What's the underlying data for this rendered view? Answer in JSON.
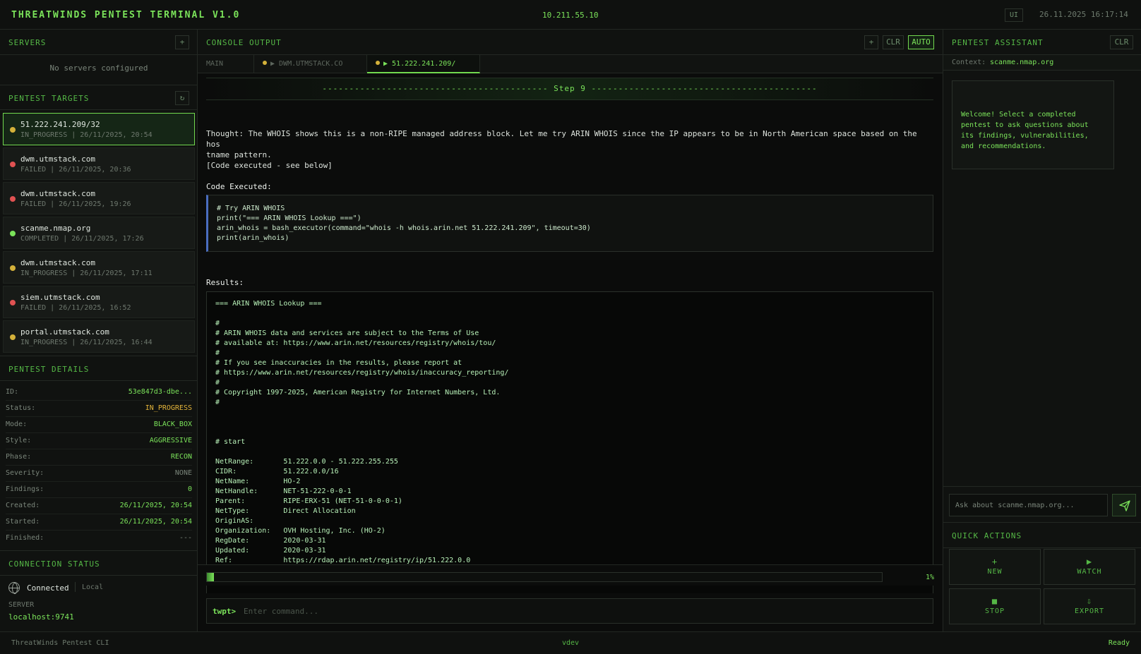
{
  "header": {
    "title": "THREATWINDS PENTEST TERMINAL V1.0",
    "ip": "10.211.55.10",
    "ui_badge": "UI",
    "datetime": "26.11.2025 16:17:14"
  },
  "colors": {
    "accent": "#7be35a",
    "status_in_progress": "#d4b13a",
    "status_failed": "#e05252",
    "status_completed": "#7be35a",
    "code_border": "#4a6dbf"
  },
  "servers": {
    "title": "SERVERS",
    "add_label": "+",
    "empty_text": "No servers configured"
  },
  "targets": {
    "title": "PENTEST TARGETS",
    "refresh_label": "↻",
    "items": [
      {
        "name": "51.222.241.209/32",
        "meta": "IN_PROGRESS | 26/11/2025, 20:54",
        "status": "in_progress"
      },
      {
        "name": "dwm.utmstack.com",
        "meta": "FAILED | 26/11/2025, 20:36",
        "status": "failed"
      },
      {
        "name": "dwm.utmstack.com",
        "meta": "FAILED | 26/11/2025, 19:26",
        "status": "failed"
      },
      {
        "name": "scanme.nmap.org",
        "meta": "COMPLETED | 26/11/2025, 17:26",
        "status": "completed"
      },
      {
        "name": "dwm.utmstack.com",
        "meta": "IN_PROGRESS | 26/11/2025, 17:11",
        "status": "in_progress"
      },
      {
        "name": "siem.utmstack.com",
        "meta": "FAILED | 26/11/2025, 16:52",
        "status": "failed"
      },
      {
        "name": "portal.utmstack.com",
        "meta": "IN_PROGRESS | 26/11/2025, 16:44",
        "status": "in_progress"
      }
    ]
  },
  "details": {
    "title": "PENTEST DETAILS",
    "rows": [
      {
        "label": "ID:",
        "value": "53e847d3-dbe...",
        "color": "#7be35a"
      },
      {
        "label": "Status:",
        "value": "IN_PROGRESS",
        "color": "#e3b43a"
      },
      {
        "label": "Mode:",
        "value": "BLACK_BOX",
        "color": "#7be35a"
      },
      {
        "label": "Style:",
        "value": "AGGRESSIVE",
        "color": "#7be35a"
      },
      {
        "label": "Phase:",
        "value": "RECON",
        "color": "#7be35a"
      },
      {
        "label": "Severity:",
        "value": "NONE",
        "color": "#7a857a"
      },
      {
        "label": "Findings:",
        "value": "0",
        "color": "#7be35a"
      },
      {
        "label": "Created:",
        "value": "26/11/2025, 20:54",
        "color": "#7be35a"
      },
      {
        "label": "Started:",
        "value": "26/11/2025, 20:54",
        "color": "#7be35a"
      },
      {
        "label": "Finished:",
        "value": "---",
        "color": "#7a857a"
      }
    ]
  },
  "connection": {
    "title": "CONNECTION STATUS",
    "state": "Connected",
    "mode": "Local",
    "server_label": "SERVER",
    "server": "localhost:9741"
  },
  "console": {
    "title": "CONSOLE OUTPUT",
    "add_label": "+",
    "clear_label": "CLR",
    "auto_label": "AUTO",
    "tabs": [
      {
        "label": "MAIN"
      },
      {
        "label": "▶ DWM.UTMSTACK.CO"
      },
      {
        "label": "▶ 51.222.241.209/"
      }
    ],
    "step_banner": "------------------------------------------ Step 9 ------------------------------------------",
    "thought_line1": "Thought: The WHOIS shows this is a non-RIPE managed address block. Let me try ARIN WHOIS since the IP appears to be in North American space based on the hos",
    "thought_line2": "tname pattern.",
    "code_note": "[Code executed - see below]",
    "code_heading": "Code Executed:",
    "code_lines": [
      "# Try ARIN WHOIS",
      "print(\"=== ARIN WHOIS Lookup ===\")",
      "arin_whois = bash_executor(command=\"whois -h whois.arin.net 51.222.241.209\", timeout=30)",
      "print(arin_whois)"
    ],
    "results_heading": "Results:",
    "result_lines": [
      "=== ARIN WHOIS Lookup ===",
      "",
      "#",
      "# ARIN WHOIS data and services are subject to the Terms of Use",
      "# available at: https://www.arin.net/resources/registry/whois/tou/",
      "#",
      "# If you see inaccuracies in the results, please report at",
      "# https://www.arin.net/resources/registry/whois/inaccuracy_reporting/",
      "#",
      "# Copyright 1997-2025, American Registry for Internet Numbers, Ltd.",
      "#",
      "",
      "",
      "",
      "# start",
      "",
      "NetRange:       51.222.0.0 - 51.222.255.255",
      "CIDR:           51.222.0.0/16",
      "NetName:        HO-2",
      "NetHandle:      NET-51-222-0-0-1",
      "Parent:         RIPE-ERX-51 (NET-51-0-0-0-1)",
      "NetType:        Direct Allocation",
      "OriginAS:",
      "Organization:   OVH Hosting, Inc. (HO-2)",
      "RegDate:        2020-03-31",
      "Updated:        2020-03-31",
      "Ref:            https://rdap.arin.net/registry/ip/51.222.0.0"
    ],
    "progress_percent": 1,
    "progress_label": "1%",
    "prompt": "twpt>",
    "input_placeholder": "Enter command..."
  },
  "assistant": {
    "title": "PENTEST ASSISTANT",
    "clear_label": "CLR",
    "context_label": "Context:",
    "context_value": "scanme.nmap.org",
    "welcome_lines": [
      "Welcome! Select a completed",
      "pentest to ask questions about",
      "its findings, vulnerabilities,",
      "and recommendations."
    ],
    "ask_placeholder": "Ask about scanme.nmap.org..."
  },
  "quick_actions": {
    "title": "QUICK ACTIONS",
    "buttons": [
      {
        "glyph": "+",
        "label": "NEW",
        "icon": "plus-icon"
      },
      {
        "glyph": "▶",
        "label": "WATCH",
        "icon": "play-icon"
      },
      {
        "glyph": "■",
        "label": "STOP",
        "icon": "stop-icon"
      },
      {
        "glyph": "⇩",
        "label": "EXPORT",
        "icon": "download-icon"
      }
    ]
  },
  "footer": {
    "left": "ThreatWinds Pentest CLI",
    "center": "vdev",
    "right": "Ready"
  }
}
